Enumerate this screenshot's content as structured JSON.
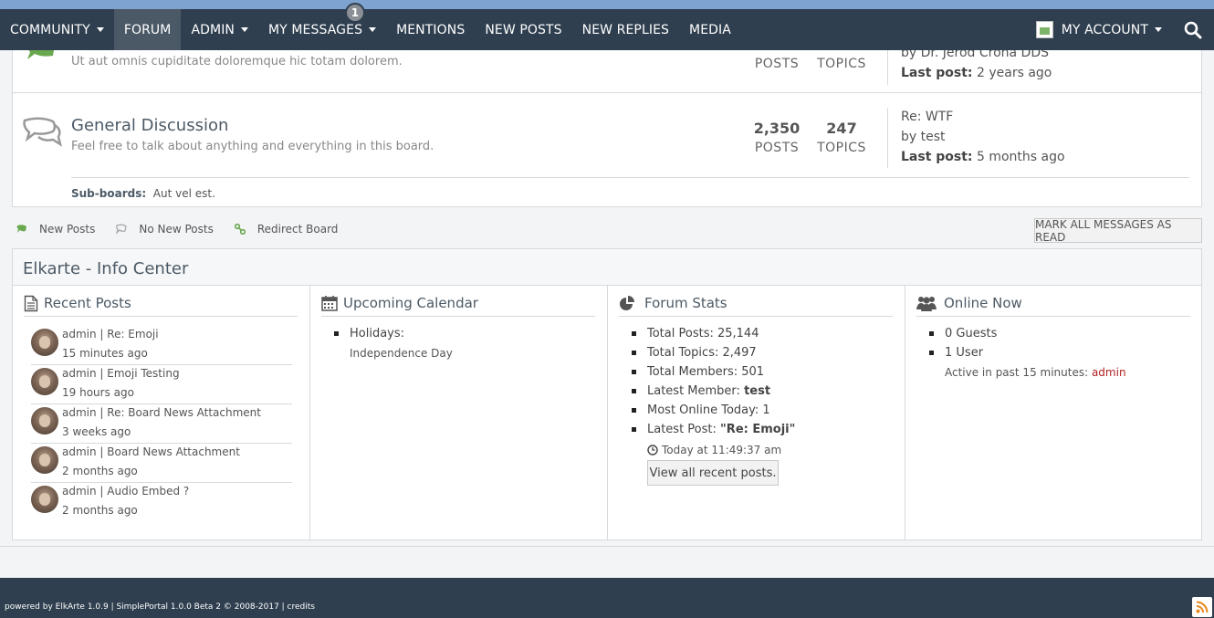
{
  "nav": {
    "items": [
      {
        "label": "COMMUNITY",
        "dropdown": true
      },
      {
        "label": "FORUM",
        "active": true
      },
      {
        "label": "ADMIN",
        "dropdown": true
      },
      {
        "label": "MY MESSAGES",
        "dropdown": true,
        "badge": "1"
      },
      {
        "label": "MENTIONS"
      },
      {
        "label": "NEW POSTS"
      },
      {
        "label": "NEW REPLIES"
      },
      {
        "label": "MEDIA"
      }
    ],
    "account_label": "MY ACCOUNT"
  },
  "boards": [
    {
      "description": "Ut aut omnis cupiditate doloremque hic totam dolorem.",
      "posts_label": "POSTS",
      "topics_label": "TOPICS",
      "last_by": "by Dr. Jerod Crona DDS",
      "last_post_label": "Last post:",
      "last_post_time": "2 years ago"
    },
    {
      "title": "General Discussion",
      "description": "Feel free to talk about anything and everything in this board.",
      "posts": "2,350",
      "posts_label": "POSTS",
      "topics": "247",
      "topics_label": "TOPICS",
      "last_subject": "Re: WTF",
      "last_by": "by test",
      "last_post_label": "Last post:",
      "last_post_time": "5 months ago",
      "subboards_label": "Sub-boards:",
      "subboards": "Aut vel est."
    }
  ],
  "legend": {
    "new_posts": "New Posts",
    "no_new_posts": "No New Posts",
    "redirect_board": "Redirect Board"
  },
  "mark_all_read": "MARK ALL MESSAGES AS READ",
  "info_center": {
    "title": "Elkarte - Info Center",
    "recent_posts": {
      "title": "Recent Posts",
      "items": [
        {
          "title": "admin | Re: Emoji",
          "time": "15 minutes ago"
        },
        {
          "title": "admin | Emoji Testing",
          "time": "19 hours ago"
        },
        {
          "title": "admin | Re: Board News Attachment",
          "time": "3 weeks ago"
        },
        {
          "title": "admin | Board News Attachment",
          "time": "2 months ago"
        },
        {
          "title": "admin | Audio Embed ?",
          "time": "2 months ago"
        }
      ]
    },
    "calendar": {
      "title": "Upcoming Calendar",
      "holidays_label": "Holidays:",
      "holiday": "Independence Day"
    },
    "stats": {
      "title": "Forum Stats",
      "total_posts": "Total Posts: 25,144",
      "total_topics": "Total Topics: 2,497",
      "total_members": "Total Members: 501",
      "latest_member_label": "Latest Member: ",
      "latest_member": "test",
      "most_online": "Most Online Today: 1",
      "latest_post_label": "Latest Post: ",
      "latest_post": "\"Re: Emoji\"",
      "latest_post_time": "Today at 11:49:37 am",
      "view_all": "View all recent posts."
    },
    "online": {
      "title": "Online Now",
      "guests": "0 Guests",
      "users": "1 User",
      "active_label": "Active in past 15 minutes: ",
      "active_user": "admin"
    }
  },
  "footer": {
    "text": "powered by ElkArte 1.0.9 | SimplePortal 1.0.0 Beta 2 © 2008-2017 | credits"
  },
  "colors": {
    "nav_bg": "#2f3f4f",
    "top_strip": "#7fa3d1",
    "accent_green": "#6aa84f",
    "admin_link": "#b22222"
  }
}
